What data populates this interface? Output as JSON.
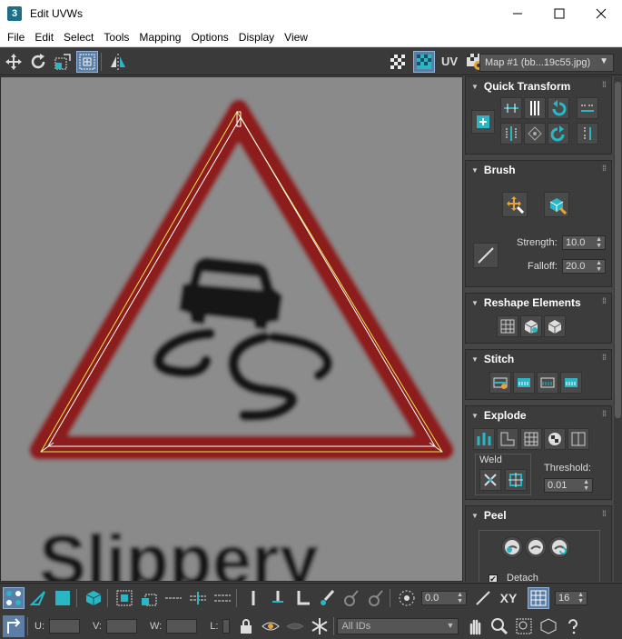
{
  "window": {
    "title": "Edit UVWs",
    "app_badge": "3"
  },
  "menu": [
    "File",
    "Edit",
    "Select",
    "Tools",
    "Mapping",
    "Options",
    "Display",
    "View"
  ],
  "toolbar": {
    "uv_label": "UV",
    "map_dropdown": "Map #1 (bb...19c55.jpg)"
  },
  "viewport": {
    "sign_text": "Slippery"
  },
  "panel": {
    "quick_transform": {
      "title": "Quick Transform"
    },
    "brush": {
      "title": "Brush",
      "strength_label": "Strength:",
      "strength_value": "10.0",
      "falloff_label": "Falloff:",
      "falloff_value": "20.0"
    },
    "reshape": {
      "title": "Reshape Elements"
    },
    "stitch": {
      "title": "Stitch"
    },
    "explode": {
      "title": "Explode",
      "weld_label": "Weld",
      "threshold_label": "Threshold:",
      "threshold_value": "0.01"
    },
    "peel": {
      "title": "Peel",
      "detach_label": "Detach",
      "detach_checked": true
    }
  },
  "bottom": {
    "soft_select_value": "0.0",
    "xy_label": "XY",
    "grid_value": "16",
    "u_label": "U:",
    "v_label": "V:",
    "w_label": "W:",
    "l_label": "L:",
    "ids_dropdown": "All IDs"
  },
  "colors": {
    "accent_blue": "#5b7ea6",
    "teal": "#2bb6c5",
    "sign_red": "#8b1c1f",
    "wire_yellow": "#e8e84a"
  }
}
